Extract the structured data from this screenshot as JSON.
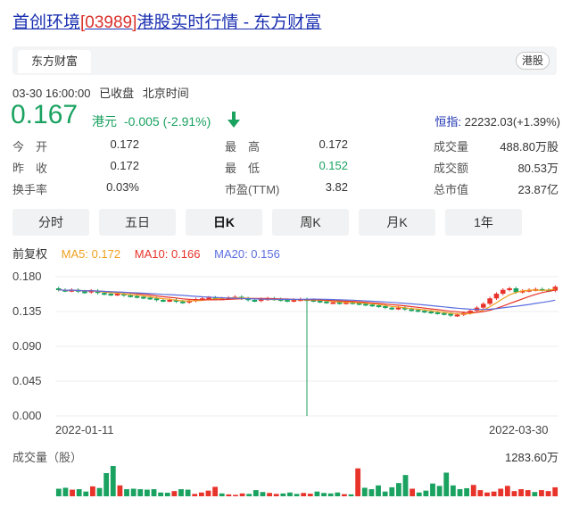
{
  "header": {
    "name": "首创环境",
    "code": "[03989]",
    "suffix": "港股实时行情 - 东方财富"
  },
  "source_bar": {
    "tab": "东方财富",
    "market_badge": "港股"
  },
  "meta": {
    "datetime": "03-30 16:00:00",
    "status": "已收盘",
    "timezone": "北京时间"
  },
  "quote": {
    "price": "0.167",
    "currency": "港元",
    "change": "-0.005",
    "change_pct": "(-2.91%)",
    "index_label": "恒指:",
    "index_value": "22232.03(+1.39%)",
    "down_color": "#1aa260",
    "up_color": "#e8332a"
  },
  "stats": [
    {
      "l1": "今　开",
      "v1": "0.172",
      "l2": "最　高",
      "v2": "0.172",
      "l3": "成交量",
      "v3": "488.80万股"
    },
    {
      "l1": "昨　收",
      "v1": "0.172",
      "l2": "最　低",
      "v2": "0.152",
      "l3": "成交额",
      "v3": "80.53万"
    },
    {
      "l1": "换手率",
      "v1": "0.03%",
      "l2": "市盈(TTM)",
      "v2": "3.82",
      "l3": "总市值",
      "v3": "23.87亿"
    }
  ],
  "period_tabs": [
    "分时",
    "五日",
    "日K",
    "周K",
    "月K",
    "1年"
  ],
  "active_tab": "日K",
  "indicators": {
    "adjust": "前复权",
    "ma5": "MA5: 0.172",
    "ma10": "MA10: 0.166",
    "ma20": "MA20: 0.156",
    "ma5_color": "#f0a020",
    "ma10_color": "#e8332a",
    "ma20_color": "#5b6ee0"
  },
  "chart_data": {
    "type": "candlestick",
    "y_ticks": [
      "0.180",
      "0.135",
      "0.090",
      "0.045",
      "0.000"
    ],
    "ylim": [
      0,
      0.18
    ],
    "x_labels": [
      "2022-01-11",
      "2022-03-30"
    ],
    "close": [
      0.163,
      0.162,
      0.163,
      0.161,
      0.16,
      0.162,
      0.159,
      0.158,
      0.157,
      0.158,
      0.156,
      0.155,
      0.154,
      0.153,
      0.152,
      0.15,
      0.149,
      0.15,
      0.148,
      0.147,
      0.149,
      0.151,
      0.152,
      0.153,
      0.152,
      0.152,
      0.153,
      0.154,
      0.152,
      0.15,
      0.149,
      0.151,
      0.152,
      0.151,
      0.15,
      0.149,
      0.15,
      0.151,
      0.15,
      0.149,
      0.148,
      0.147,
      0.147,
      0.146,
      0.147,
      0.146,
      0.145,
      0.144,
      0.143,
      0.142,
      0.14,
      0.139,
      0.14,
      0.138,
      0.137,
      0.136,
      0.135,
      0.134,
      0.133,
      0.132,
      0.13,
      0.131,
      0.133,
      0.136,
      0.14,
      0.145,
      0.152,
      0.158,
      0.163,
      0.165,
      0.16,
      0.162,
      0.163,
      0.164,
      0.163,
      0.162,
      0.167
    ],
    "volume_max": "1283.60万",
    "volume_title": "成交量（股）",
    "volumes": [
      320,
      360,
      280,
      300,
      200,
      420,
      350,
      980,
      1283,
      460,
      300,
      320,
      300,
      280,
      300,
      160,
      150,
      220,
      300,
      280,
      100,
      160,
      240,
      400,
      120,
      80,
      60,
      120,
      100,
      260,
      180,
      140,
      100,
      120,
      160,
      100,
      140,
      110,
      200,
      140,
      120,
      160,
      90,
      80,
      1180,
      360,
      300,
      460,
      200,
      380,
      560,
      900,
      320,
      160,
      240,
      540,
      440,
      1000,
      460,
      300,
      340,
      480,
      260,
      160,
      200,
      320,
      440,
      220,
      300,
      260,
      180,
      260,
      220,
      380
    ]
  }
}
